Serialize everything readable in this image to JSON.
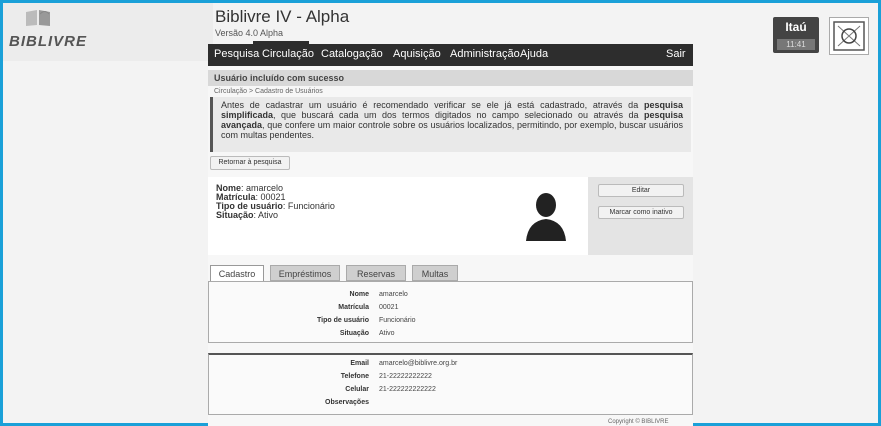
{
  "app": {
    "title": "Biblivre IV - Alpha",
    "version": "Versão 4.0 Alpha",
    "logo_text": "BIBLIVRE"
  },
  "menu": {
    "items": [
      "Pesquisa",
      "Circulação",
      "Catalogação",
      "Aquisição",
      "Administração",
      "Ajuda"
    ],
    "logout": "Sair"
  },
  "institution": {
    "name": "Itaú",
    "time": "11:41"
  },
  "notice": "Usuário incluído com sucesso",
  "breadcrumb": "Circulação > Cadastro de Usuários",
  "info": {
    "before_simple": "Antes de cadastrar um usuário é recomendado verificar se ele já está cadastrado, através da ",
    "simple_link": "pesquisa simplificada",
    "mid1": ", que buscará cada um dos termos digitados no campo selecionado ou através da ",
    "advanced_link": "pesquisa avançada",
    "after": ", que confere um maior controle sobre os usuários localizados, permitindo, por exemplo, buscar usuários com multas pendentes."
  },
  "back_button": "Retornar à pesquisa",
  "user": {
    "name_label": "Nome",
    "name": "amarcelo",
    "registration_label": "Matrícula",
    "registration": "00021",
    "type_label": "Tipo de usuário",
    "type": "Funcionário",
    "status_label": "Situação",
    "status": "Ativo"
  },
  "actions": {
    "edit": "Editar",
    "mark_inactive": "Marcar como inativo"
  },
  "tabs": [
    "Cadastro",
    "Empréstimos",
    "Reservas",
    "Multas"
  ],
  "details": {
    "name_label": "Nome",
    "name": "amarcelo",
    "registration_label": "Matrícula",
    "registration": "00021",
    "type_label": "Tipo de usuário",
    "type": "Funcionário",
    "status_label": "Situação",
    "status": "Ativo"
  },
  "contact": {
    "email_label": "Email",
    "email": "amarcelo@biblivre.org.br",
    "phone_label": "Telefone",
    "phone": "21-22222222222",
    "cell_label": "Celular",
    "cell": "21-222222222222",
    "notes_label": "Observações",
    "notes": ""
  },
  "copyright": "Copyright © BIBLIVRE"
}
